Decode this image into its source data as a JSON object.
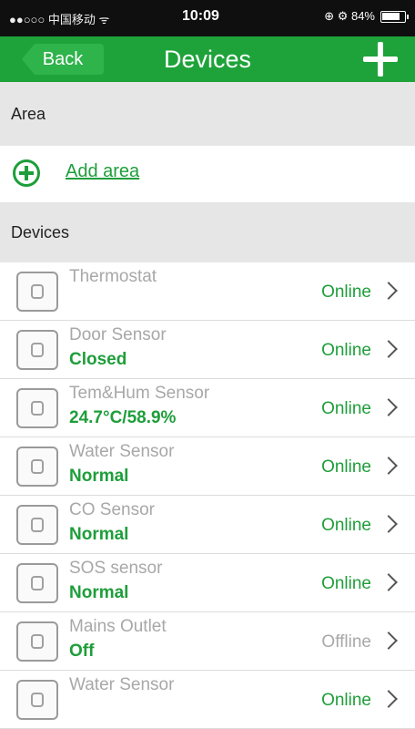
{
  "status_bar": {
    "carrier": "●●○○○ 中国移动 ᯤ",
    "time": "10:09",
    "right": "⊕ ⚙ 84%"
  },
  "nav": {
    "back_label": "Back",
    "title": "Devices"
  },
  "area_section": {
    "header": "Area",
    "add_label": "Add area"
  },
  "devices_section": {
    "header": "Devices",
    "items": [
      {
        "name": "Thermostat",
        "state": "",
        "status": "Online",
        "icon": "thermostat-icon"
      },
      {
        "name": "Door Sensor",
        "state": "Closed",
        "status": "Online",
        "icon": "door-sensor-icon"
      },
      {
        "name": "Tem&Hum Sensor",
        "state": "24.7°C/58.9%",
        "status": "Online",
        "icon": "temhum-sensor-icon"
      },
      {
        "name": "Water Sensor",
        "state": "Normal",
        "status": "Online",
        "icon": "water-sensor-icon"
      },
      {
        "name": "CO Sensor",
        "state": "Normal",
        "status": "Online",
        "icon": "co-sensor-icon"
      },
      {
        "name": "SOS sensor",
        "state": "Normal",
        "status": "Online",
        "icon": "sos-sensor-icon"
      },
      {
        "name": "Mains Outlet",
        "state": "Off",
        "status": "Offline",
        "icon": "mains-outlet-icon"
      },
      {
        "name": "Water Sensor",
        "state": "",
        "status": "Online",
        "icon": "water-sensor-icon"
      }
    ]
  },
  "colors": {
    "accent": "#1ea33a",
    "online": "#1e9e3a",
    "offline": "#a8a8a8"
  }
}
